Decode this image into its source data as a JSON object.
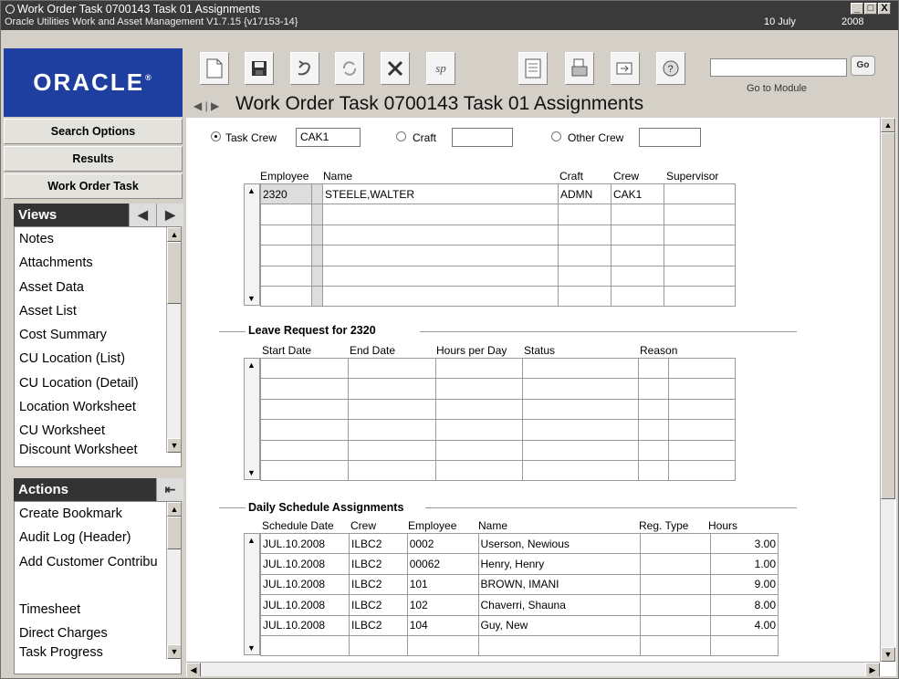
{
  "window": {
    "title": "Work Order Task 0700143 Task 01 Assignments",
    "subtitle": "Oracle Utilities Work and Asset Management V1.7.15 {v17153-14}",
    "date": "10 July",
    "year": "2008",
    "controls": [
      "_",
      "□",
      "X"
    ]
  },
  "logo": "ORACLE",
  "toolbar": {
    "icons": [
      "new-icon",
      "save-icon",
      "undo-icon",
      "refresh-icon",
      "delete-icon",
      "spell-check-icon",
      "report-icon",
      "print-icon",
      "route-icon",
      "help-icon"
    ],
    "go_label": "Go",
    "go_to_module_label": "Go to Module",
    "module_input_value": ""
  },
  "page_title": "Work Order Task 0700143 Task 01 Assignments",
  "sidebar": {
    "buttons": [
      "Search Options",
      "Results",
      "Work Order Task"
    ],
    "views_title": "Views",
    "views": [
      "Notes",
      "Attachments",
      "Asset Data",
      "Asset List",
      "Cost Summary",
      "CU Location (List)",
      "CU Location (Detail)",
      " Location Worksheet",
      "CU Worksheet",
      "Discount Worksheet"
    ],
    "actions_title": "Actions",
    "actions": [
      "Create Bookmark",
      "Audit Log (Header)",
      "Add Customer Contribu",
      "",
      "Timesheet",
      "Direct Charges",
      "Task Progress"
    ]
  },
  "crew_select": {
    "task_crew_label": "Task Crew",
    "task_crew_value": "CAK1",
    "craft_label": "Craft",
    "craft_value": "",
    "other_crew_label": "Other Crew",
    "other_crew_value": ""
  },
  "employees": {
    "headers": [
      "Employee",
      "Name",
      "Craft",
      "Crew",
      "Supervisor"
    ],
    "rows": [
      [
        "2320",
        "STEELE,WALTER",
        "ADMN",
        "CAK1",
        ""
      ],
      [
        "",
        "",
        "",
        "",
        ""
      ],
      [
        "",
        "",
        "",
        "",
        ""
      ],
      [
        "",
        "",
        "",
        "",
        ""
      ],
      [
        "",
        "",
        "",
        "",
        ""
      ],
      [
        "",
        "",
        "",
        "",
        ""
      ]
    ]
  },
  "leave": {
    "title": "Leave Request for 2320",
    "headers": [
      "Start Date",
      "End Date",
      "Hours per Day",
      "Status",
      "Reason"
    ],
    "rows": [
      [
        "",
        "",
        "",
        "",
        "",
        ""
      ],
      [
        "",
        "",
        "",
        "",
        "",
        ""
      ],
      [
        "",
        "",
        "",
        "",
        "",
        ""
      ],
      [
        "",
        "",
        "",
        "",
        "",
        ""
      ],
      [
        "",
        "",
        "",
        "",
        "",
        ""
      ],
      [
        "",
        "",
        "",
        "",
        "",
        ""
      ]
    ]
  },
  "schedule": {
    "title": "Daily Schedule Assignments",
    "headers": [
      "Schedule Date",
      "Crew",
      "Employee",
      "Name",
      "Reg. Type",
      "Hours"
    ],
    "rows": [
      [
        "JUL.10.2008",
        "ILBC2",
        "0002",
        "Userson, Newious",
        "",
        "3.00"
      ],
      [
        "JUL.10.2008",
        "ILBC2",
        "00062",
        "Henry, Henry",
        "",
        "1.00"
      ],
      [
        "JUL.10.2008",
        "ILBC2",
        "101",
        "BROWN, IMANI",
        "",
        "9.00"
      ],
      [
        "JUL.10.2008",
        "ILBC2",
        "102",
        "Chaverri, Shauna",
        "",
        "8.00"
      ],
      [
        "JUL.10.2008",
        "ILBC2",
        "104",
        "Guy, New",
        "",
        "4.00"
      ],
      [
        "",
        "",
        "",
        "",
        "",
        ""
      ]
    ]
  }
}
